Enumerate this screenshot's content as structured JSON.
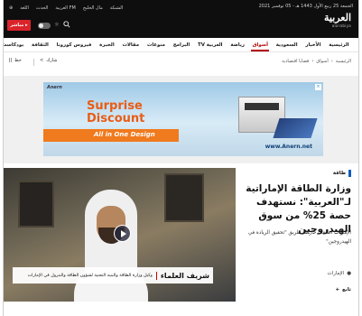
{
  "topbar": {
    "date": "الجمعة 25 ربيع الأول 1443 هـ - 05 نوفمبر 2021",
    "links": [
      "الحدث",
      "العربية FM",
      "مال الخليج",
      "الشبكة"
    ],
    "lang": "اللغة",
    "live_label": "مباشر",
    "logo_ar": "العربية",
    "logo_en": "alarabiya"
  },
  "nav": {
    "items": [
      "الرئيسية",
      "الأخبار",
      "السعودية",
      "أسواق",
      "رياضة",
      "العربية TV",
      "البرامج",
      "منوعات",
      "مقالات",
      "الخبرة",
      "فيروس كورونا",
      "الثقافة",
      "بودكاست"
    ],
    "active_index": 3
  },
  "subrow": {
    "crumbs": [
      "الرئيسية",
      "أسواق",
      "قضايا اقتصادية"
    ],
    "share": "شارك",
    "font": "خط"
  },
  "ad": {
    "brand": "Anern",
    "line1": "Surprise",
    "line2": "Discount",
    "bar_text": "All in One Design",
    "url": "www.Anern.net"
  },
  "article": {
    "tag": "طاقة",
    "headline": "وزارة الطاقة الإماراتية لـ\"العربية\": نستهدف حصة 25% من سوق الهيدروجين",
    "summary": "الإمارات أطلقت خارطة طريق \"تحقيق الريادة في الهيدروجين\"",
    "location": "الإمارات",
    "follow": "تابع",
    "caption_name": "شريف العلماء",
    "caption_role": "وكيل وزارة الطاقة والبنية التحتية لشؤون الطاقة والبترول في الإمارات"
  },
  "colors": {
    "accent": "#b30000",
    "live": "#d9242b",
    "tag": "#0a5dc2"
  }
}
